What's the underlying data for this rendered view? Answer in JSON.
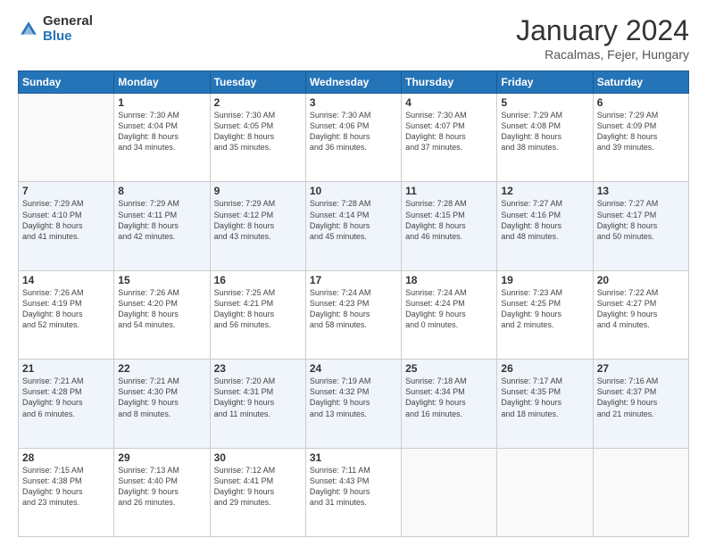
{
  "header": {
    "logo_general": "General",
    "logo_blue": "Blue",
    "month_title": "January 2024",
    "location": "Racalmas, Fejer, Hungary"
  },
  "weekdays": [
    "Sunday",
    "Monday",
    "Tuesday",
    "Wednesday",
    "Thursday",
    "Friday",
    "Saturday"
  ],
  "weeks": [
    [
      {
        "day": "",
        "info": ""
      },
      {
        "day": "1",
        "info": "Sunrise: 7:30 AM\nSunset: 4:04 PM\nDaylight: 8 hours\nand 34 minutes."
      },
      {
        "day": "2",
        "info": "Sunrise: 7:30 AM\nSunset: 4:05 PM\nDaylight: 8 hours\nand 35 minutes."
      },
      {
        "day": "3",
        "info": "Sunrise: 7:30 AM\nSunset: 4:06 PM\nDaylight: 8 hours\nand 36 minutes."
      },
      {
        "day": "4",
        "info": "Sunrise: 7:30 AM\nSunset: 4:07 PM\nDaylight: 8 hours\nand 37 minutes."
      },
      {
        "day": "5",
        "info": "Sunrise: 7:29 AM\nSunset: 4:08 PM\nDaylight: 8 hours\nand 38 minutes."
      },
      {
        "day": "6",
        "info": "Sunrise: 7:29 AM\nSunset: 4:09 PM\nDaylight: 8 hours\nand 39 minutes."
      }
    ],
    [
      {
        "day": "7",
        "info": "Sunrise: 7:29 AM\nSunset: 4:10 PM\nDaylight: 8 hours\nand 41 minutes."
      },
      {
        "day": "8",
        "info": "Sunrise: 7:29 AM\nSunset: 4:11 PM\nDaylight: 8 hours\nand 42 minutes."
      },
      {
        "day": "9",
        "info": "Sunrise: 7:29 AM\nSunset: 4:12 PM\nDaylight: 8 hours\nand 43 minutes."
      },
      {
        "day": "10",
        "info": "Sunrise: 7:28 AM\nSunset: 4:14 PM\nDaylight: 8 hours\nand 45 minutes."
      },
      {
        "day": "11",
        "info": "Sunrise: 7:28 AM\nSunset: 4:15 PM\nDaylight: 8 hours\nand 46 minutes."
      },
      {
        "day": "12",
        "info": "Sunrise: 7:27 AM\nSunset: 4:16 PM\nDaylight: 8 hours\nand 48 minutes."
      },
      {
        "day": "13",
        "info": "Sunrise: 7:27 AM\nSunset: 4:17 PM\nDaylight: 8 hours\nand 50 minutes."
      }
    ],
    [
      {
        "day": "14",
        "info": "Sunrise: 7:26 AM\nSunset: 4:19 PM\nDaylight: 8 hours\nand 52 minutes."
      },
      {
        "day": "15",
        "info": "Sunrise: 7:26 AM\nSunset: 4:20 PM\nDaylight: 8 hours\nand 54 minutes."
      },
      {
        "day": "16",
        "info": "Sunrise: 7:25 AM\nSunset: 4:21 PM\nDaylight: 8 hours\nand 56 minutes."
      },
      {
        "day": "17",
        "info": "Sunrise: 7:24 AM\nSunset: 4:23 PM\nDaylight: 8 hours\nand 58 minutes."
      },
      {
        "day": "18",
        "info": "Sunrise: 7:24 AM\nSunset: 4:24 PM\nDaylight: 9 hours\nand 0 minutes."
      },
      {
        "day": "19",
        "info": "Sunrise: 7:23 AM\nSunset: 4:25 PM\nDaylight: 9 hours\nand 2 minutes."
      },
      {
        "day": "20",
        "info": "Sunrise: 7:22 AM\nSunset: 4:27 PM\nDaylight: 9 hours\nand 4 minutes."
      }
    ],
    [
      {
        "day": "21",
        "info": "Sunrise: 7:21 AM\nSunset: 4:28 PM\nDaylight: 9 hours\nand 6 minutes."
      },
      {
        "day": "22",
        "info": "Sunrise: 7:21 AM\nSunset: 4:30 PM\nDaylight: 9 hours\nand 8 minutes."
      },
      {
        "day": "23",
        "info": "Sunrise: 7:20 AM\nSunset: 4:31 PM\nDaylight: 9 hours\nand 11 minutes."
      },
      {
        "day": "24",
        "info": "Sunrise: 7:19 AM\nSunset: 4:32 PM\nDaylight: 9 hours\nand 13 minutes."
      },
      {
        "day": "25",
        "info": "Sunrise: 7:18 AM\nSunset: 4:34 PM\nDaylight: 9 hours\nand 16 minutes."
      },
      {
        "day": "26",
        "info": "Sunrise: 7:17 AM\nSunset: 4:35 PM\nDaylight: 9 hours\nand 18 minutes."
      },
      {
        "day": "27",
        "info": "Sunrise: 7:16 AM\nSunset: 4:37 PM\nDaylight: 9 hours\nand 21 minutes."
      }
    ],
    [
      {
        "day": "28",
        "info": "Sunrise: 7:15 AM\nSunset: 4:38 PM\nDaylight: 9 hours\nand 23 minutes."
      },
      {
        "day": "29",
        "info": "Sunrise: 7:13 AM\nSunset: 4:40 PM\nDaylight: 9 hours\nand 26 minutes."
      },
      {
        "day": "30",
        "info": "Sunrise: 7:12 AM\nSunset: 4:41 PM\nDaylight: 9 hours\nand 29 minutes."
      },
      {
        "day": "31",
        "info": "Sunrise: 7:11 AM\nSunset: 4:43 PM\nDaylight: 9 hours\nand 31 minutes."
      },
      {
        "day": "",
        "info": ""
      },
      {
        "day": "",
        "info": ""
      },
      {
        "day": "",
        "info": ""
      }
    ]
  ]
}
